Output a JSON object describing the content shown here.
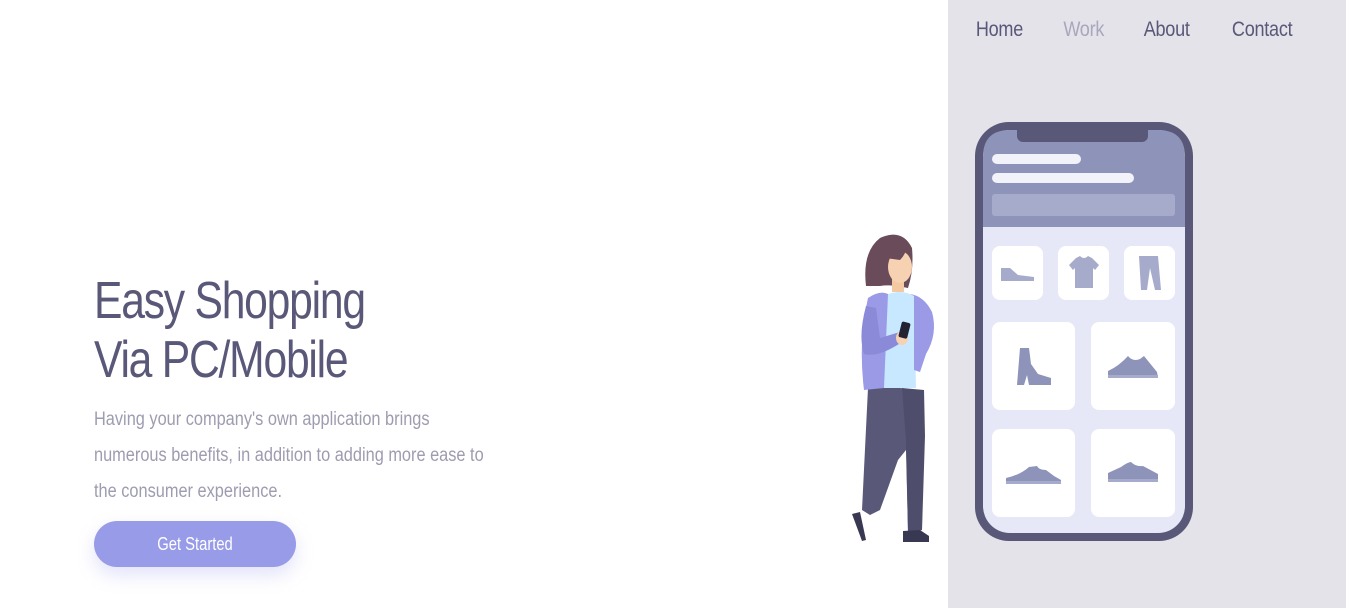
{
  "nav": {
    "items": [
      {
        "label": "Home",
        "active": false
      },
      {
        "label": "Work",
        "active": true
      },
      {
        "label": "About",
        "active": false
      },
      {
        "label": "Contact",
        "active": false
      }
    ]
  },
  "hero": {
    "title_line1": "Easy Shopping",
    "title_line2": "Via PC/Mobile",
    "description": "Having your company's own application brings numerous benefits, in addition to adding more ease to the consumer experience.",
    "cta_label": "Get Started"
  },
  "colors": {
    "accent": "#979be8",
    "text_dark": "#595878",
    "text_muted": "#9d9cb0",
    "nav_active": "#a8a7bd",
    "panel_bg": "#e4e3ea",
    "phone_frame": "#595878",
    "phone_header": "#8e94b9"
  },
  "illustration": {
    "icons": [
      "woman-figure",
      "smartphone",
      "flat-shoe-icon",
      "t-shirt-icon",
      "pants-icon",
      "ankle-boot-icon",
      "sneaker-icon"
    ]
  }
}
